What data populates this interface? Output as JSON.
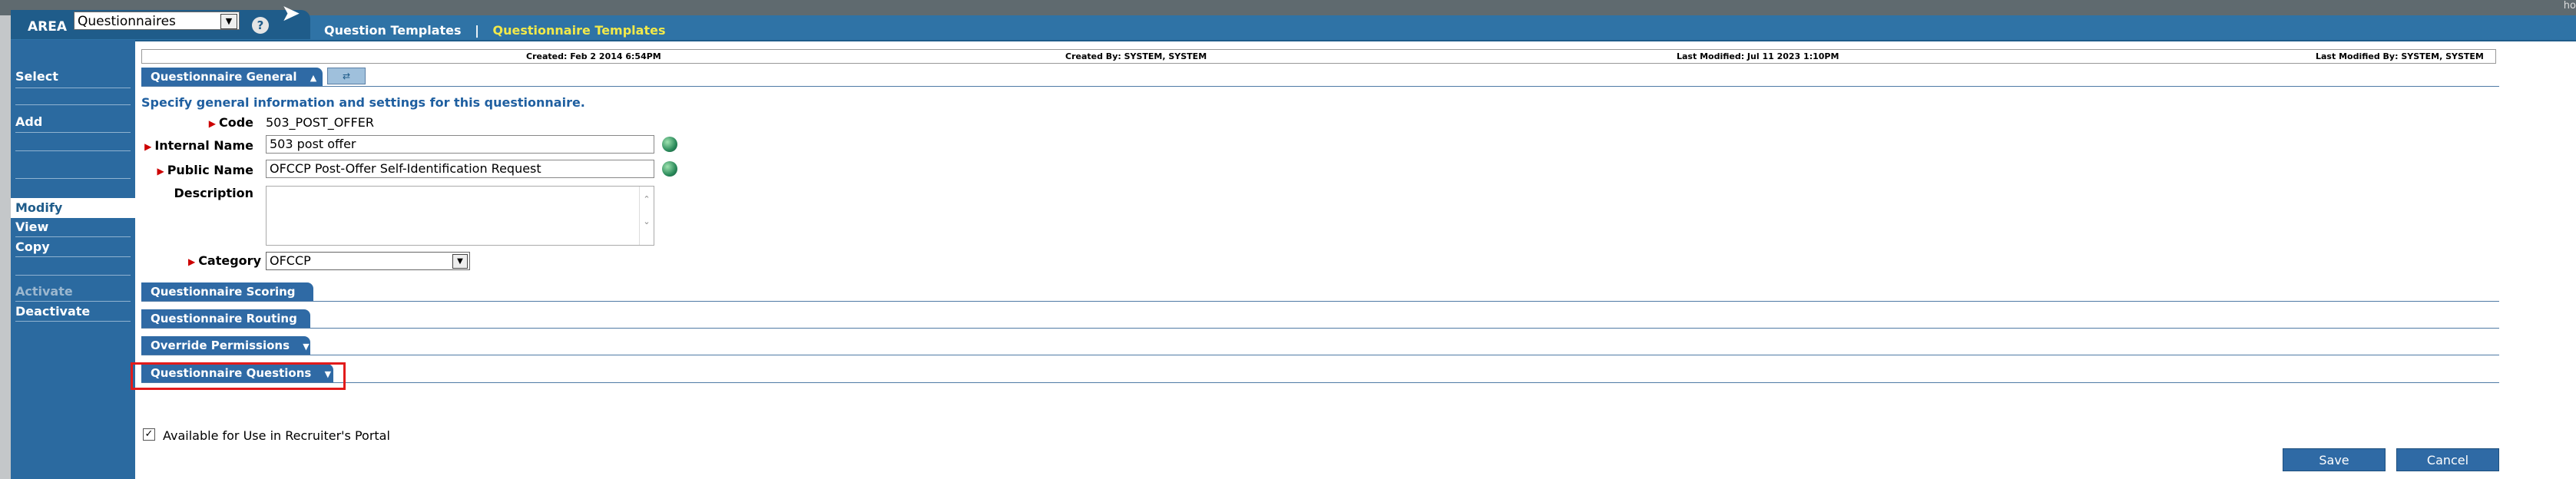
{
  "topbar": {
    "corner_text": "ho"
  },
  "header": {
    "area_label": "AREA",
    "area_value": "Questionnaires",
    "help": "?",
    "nav": [
      {
        "label": "Question Templates",
        "active": false
      },
      {
        "label": "Questionnaire Templates",
        "active": true
      }
    ],
    "nav_separator": "|"
  },
  "sidebar": {
    "select": "Select",
    "add": "Add",
    "modify": "Modify",
    "view": "View",
    "copy": "Copy",
    "activate": "Activate",
    "deactivate": "Deactivate"
  },
  "info": {
    "created": "Created: Feb 2 2014 6:54PM",
    "created_by": "Created By: SYSTEM, SYSTEM",
    "last_modified": "Last Modified: Jul 11 2023 1:10PM",
    "last_modified_by": "Last Modified By: SYSTEM, SYSTEM"
  },
  "sections": {
    "general": "Questionnaire General",
    "scoring": "Questionnaire Scoring",
    "routing": "Questionnaire Routing",
    "permissions": "Override Permissions",
    "questions": "Questionnaire Questions"
  },
  "form": {
    "intro": "Specify general information and settings for this questionnaire.",
    "code_label": "Code",
    "code_value": "503_POST_OFFER",
    "internal_name_label": "Internal Name",
    "internal_name_value": "503 post offer",
    "public_name_label": "Public Name",
    "public_name_value": "OFCCP Post-Offer Self-Identification Request",
    "description_label": "Description",
    "description_value": "",
    "category_label": "Category",
    "category_value": "OFCCP"
  },
  "checkbox": {
    "label": "Available for Use in Recruiter's Portal",
    "checked": true
  },
  "buttons": {
    "save": "Save",
    "cancel": "Cancel"
  }
}
